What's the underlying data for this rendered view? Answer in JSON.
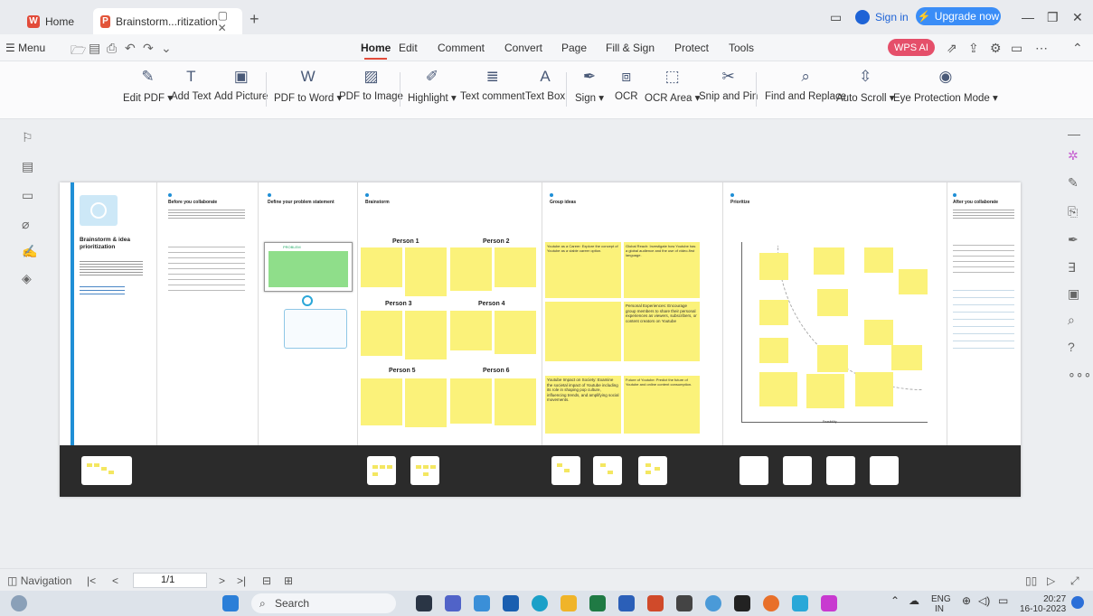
{
  "titlebar": {
    "home_tab": "Home",
    "doc_tab": "Brainstorm...ritization",
    "sign_in": "Sign in",
    "upgrade": "Upgrade now"
  },
  "menu": {
    "menu_label": "Menu",
    "tabs": [
      "Home",
      "Edit",
      "Comment",
      "Convert",
      "Page",
      "Fill & Sign",
      "Protect",
      "Tools"
    ],
    "active_tab": "Home",
    "wps_ai": "WPS AI"
  },
  "ribbon": {
    "tools": [
      {
        "label": "Edit PDF ▾",
        "icon": "edit-pdf-icon",
        "glyph": "✎"
      },
      {
        "label": "Add Text",
        "icon": "add-text-icon",
        "glyph": "T"
      },
      {
        "label": "Add Picture",
        "icon": "add-picture-icon",
        "glyph": "▣"
      },
      {
        "label": "PDF to Word ▾",
        "icon": "pdf-to-word-icon",
        "glyph": "W"
      },
      {
        "label": "PDF to Image",
        "icon": "pdf-to-image-icon",
        "glyph": "▨"
      },
      {
        "label": "Highlight ▾",
        "icon": "highlight-icon",
        "glyph": "✐"
      },
      {
        "label": "Text comment",
        "icon": "text-comment-icon",
        "glyph": "≣"
      },
      {
        "label": "Text Box",
        "icon": "text-box-icon",
        "glyph": "A"
      },
      {
        "label": "Sign ▾",
        "icon": "sign-icon",
        "glyph": "✒"
      },
      {
        "label": "OCR",
        "icon": "ocr-icon",
        "glyph": "⧈"
      },
      {
        "label": "OCR Area ▾",
        "icon": "ocr-area-icon",
        "glyph": "⬚"
      },
      {
        "label": "Snip and Pin",
        "icon": "snip-pin-icon",
        "glyph": "✂"
      },
      {
        "label": "Find and Replace",
        "icon": "find-replace-icon",
        "glyph": "⌕"
      },
      {
        "label": "Auto Scroll ▾",
        "icon": "auto-scroll-icon",
        "glyph": "⇳"
      },
      {
        "label": "Eye Protection Mode ▾",
        "icon": "eye-protection-icon",
        "glyph": "◉"
      }
    ]
  },
  "document": {
    "panels": [
      {
        "title": "Brainstorm & idea prioritization"
      },
      {
        "title": "Before you collaborate"
      },
      {
        "title": "Define your problem statement"
      },
      {
        "title": "Brainstorm"
      },
      {
        "title": "Group ideas"
      },
      {
        "title": "Prioritize"
      },
      {
        "title": "After you collaborate"
      }
    ],
    "problem_label": "PROBLEM",
    "persons": [
      "Person 1",
      "Person 2",
      "Person 3",
      "Person 4",
      "Person 5",
      "Person 6"
    ],
    "group_notes": [
      "Youtube as a Career: Explore the concept of Youtube as a viable career option.",
      "Global Reach: Investigate how Youtube has a global audience and the use of video-first language.",
      "Personal Experiences: Encourage group members to share their personal experiences as viewers, subscribers, or content creators on Youtube",
      "Youtube Impact on Society: Examine the societal impact of Youtube including its role in shaping pop culture, influencing trends, and amplifying social movements.",
      "Future of Youtube: Predict the future of Youtube and online content consumption."
    ],
    "axis_label": "Feasibility"
  },
  "nav": {
    "navigation": "Navigation",
    "page": "1/1"
  },
  "taskbar": {
    "search": "Search",
    "lang_top": "ENG",
    "lang_bottom": "IN",
    "time": "20:27",
    "date": "16-10-2023"
  }
}
